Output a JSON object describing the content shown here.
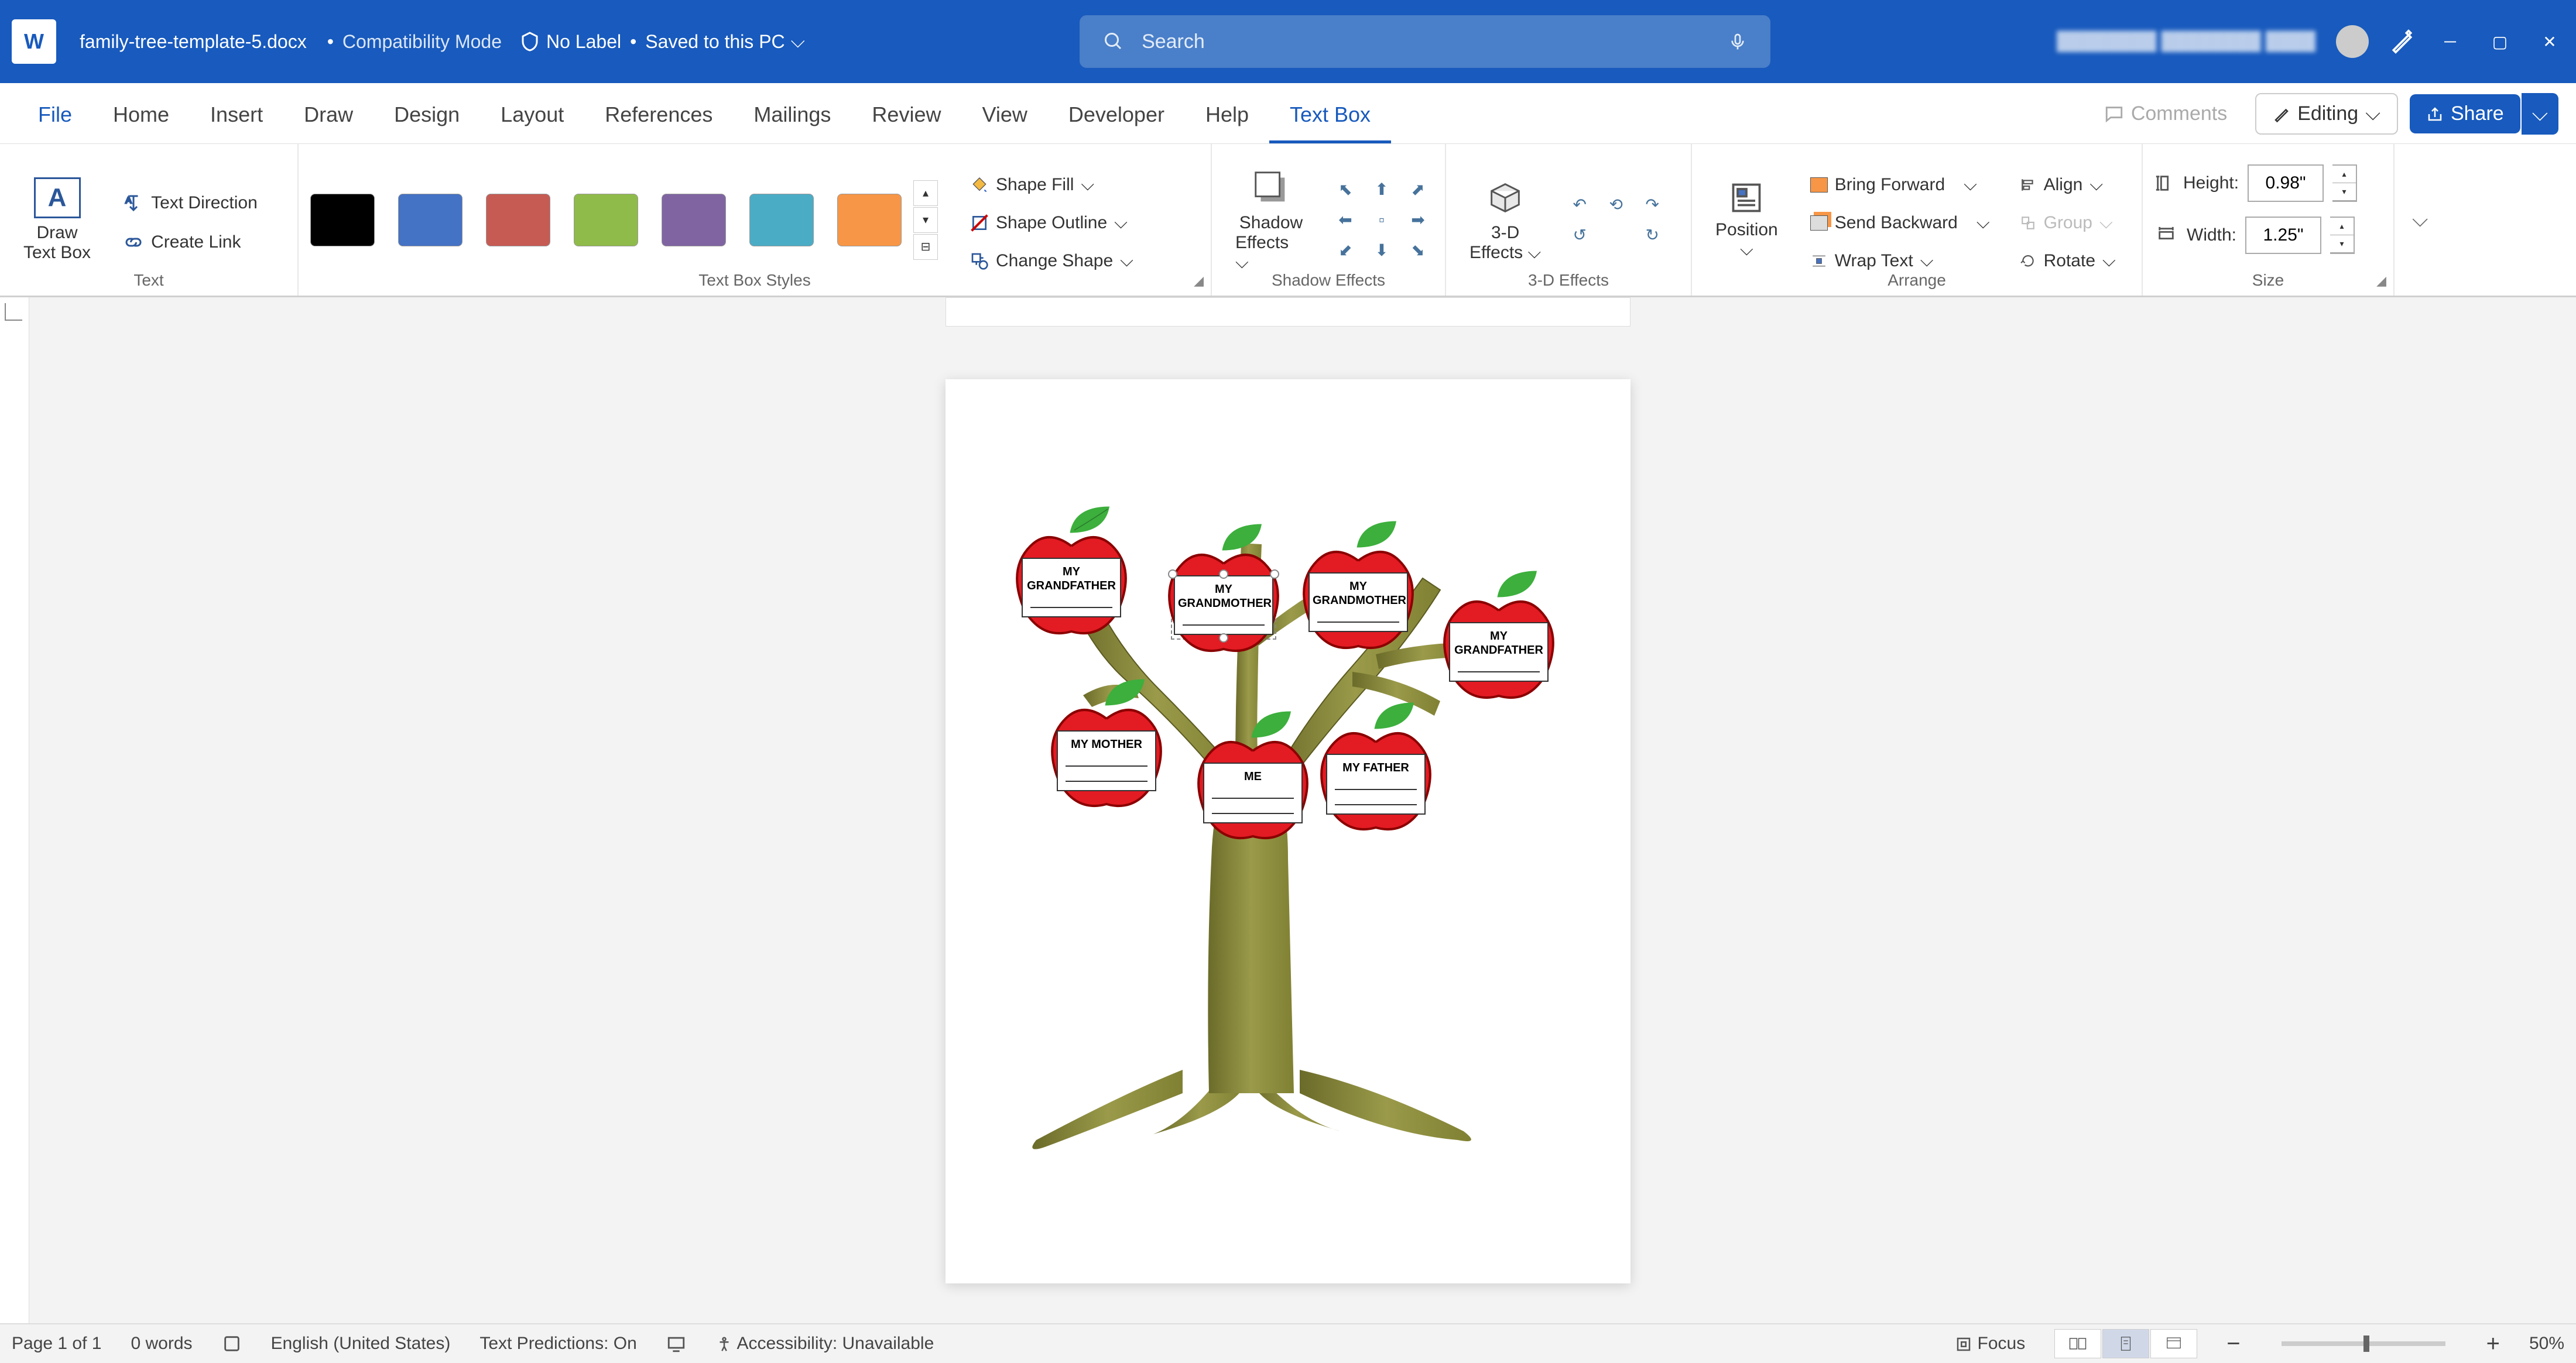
{
  "titlebar": {
    "app_letter": "W",
    "doc_name": "family-tree-template-5.docx",
    "separator": "•",
    "compat": "Compatibility Mode",
    "nolabel": "No Label",
    "saved": "Saved to this PC",
    "search_placeholder": "Search",
    "user_blur": "████████ ████████ ████"
  },
  "tabs": {
    "file": "File",
    "home": "Home",
    "insert": "Insert",
    "draw": "Draw",
    "design": "Design",
    "layout": "Layout",
    "references": "References",
    "mailings": "Mailings",
    "review": "Review",
    "view": "View",
    "developer": "Developer",
    "help": "Help",
    "textbox": "Text Box",
    "comments": "Comments",
    "editing": "Editing",
    "share": "Share"
  },
  "ribbon": {
    "text": {
      "draw_tb1": "Draw",
      "draw_tb2": "Text Box",
      "text_dir": "Text Direction",
      "create_link": "Create Link",
      "label": "Text"
    },
    "styles": {
      "colors": [
        "#000000",
        "#4472C4",
        "#C65B54",
        "#8FBB4A",
        "#8064A2",
        "#4BACC6",
        "#F79646"
      ],
      "label": "Text Box Styles",
      "shape_fill": "Shape Fill",
      "shape_outline": "Shape Outline",
      "change_shape": "Change Shape"
    },
    "shadow": {
      "btn1": "Shadow",
      "btn2": "Effects",
      "label": "Shadow Effects"
    },
    "threed": {
      "btn1": "3-D",
      "btn2": "Effects",
      "label": "3-D Effects"
    },
    "arrange": {
      "position": "Position",
      "bring_fwd": "Bring Forward",
      "send_back": "Send Backward",
      "wrap": "Wrap Text",
      "align": "Align",
      "group": "Group",
      "rotate": "Rotate",
      "label": "Arrange"
    },
    "size": {
      "height_lbl": "Height:",
      "height_val": "0.98\"",
      "width_lbl": "Width:",
      "width_val": "1.25\"",
      "label": "Size"
    }
  },
  "tree": {
    "apples": [
      {
        "id": "gf1",
        "label1": "MY",
        "label2": "GRANDFATHER"
      },
      {
        "id": "gm1",
        "label1": "MY",
        "label2": "GRANDMOTHER"
      },
      {
        "id": "gm2",
        "label1": "MY",
        "label2": "GRANDMOTHER"
      },
      {
        "id": "gf2",
        "label1": "MY",
        "label2": "GRANDFATHER"
      },
      {
        "id": "mom",
        "label1": "MY MOTHER",
        "label2": ""
      },
      {
        "id": "me",
        "label1": "ME",
        "label2": ""
      },
      {
        "id": "dad",
        "label1": "MY FATHER",
        "label2": ""
      }
    ]
  },
  "statusbar": {
    "page": "Page 1 of 1",
    "words": "0 words",
    "lang": "English (United States)",
    "pred": "Text Predictions: On",
    "acc": "Accessibility: Unavailable",
    "focus": "Focus",
    "zoom": "50%"
  }
}
